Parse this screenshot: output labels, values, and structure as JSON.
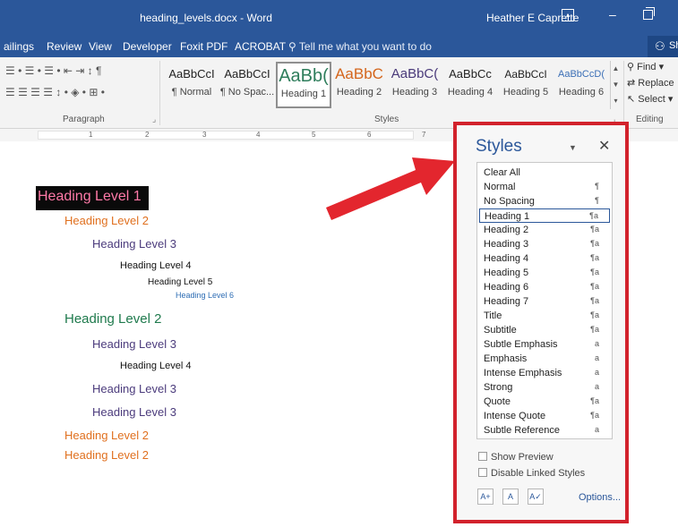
{
  "titlebar": {
    "doc_title": "heading_levels.docx - Word",
    "user": "Heather E Caprette",
    "ribbon_display_icon": "ribbon-display-options-icon",
    "minimize_glyph": "–",
    "restore_icon": "restore-window-icon"
  },
  "tabs": {
    "items": [
      "ailings",
      "Review",
      "View",
      "Developer",
      "Foxit PDF",
      "ACROBAT"
    ],
    "tell_me": "Tell me what you want to do",
    "share": "Sh"
  },
  "ribbon": {
    "paragraph_label": "Paragraph",
    "styles_label": "Styles",
    "editing_label": "Editing",
    "paragraph_row1": "☰ • ☰ • ☰ • ⇤ ⇥  ↕  ¶",
    "paragraph_row2": "☰ ☰ ☰ ☰  ↕ •  ◈ •  ⊞ •",
    "gallery": [
      {
        "sample": "AaBbCcI",
        "name": "¶ Normal",
        "color": "#222222"
      },
      {
        "sample": "AaBbCcI",
        "name": "¶ No Spac...",
        "color": "#222222"
      },
      {
        "sample": "AaBb(",
        "name": "Heading 1",
        "color": "#2e7d5b"
      },
      {
        "sample": "AaBbC",
        "name": "Heading 2",
        "color": "#d4661c"
      },
      {
        "sample": "AaBbC(",
        "name": "Heading 3",
        "color": "#4a3a7a"
      },
      {
        "sample": "AaBbCc",
        "name": "Heading 4",
        "color": "#222222"
      },
      {
        "sample": "AaBbCcI",
        "name": "Heading 5",
        "color": "#222222"
      },
      {
        "sample": "AaBbCcD(",
        "name": "Heading 6",
        "color": "#3b6fb6"
      }
    ],
    "editing": {
      "find": "Find",
      "replace": "Replace",
      "select": "Select"
    }
  },
  "ruler": {
    "numbers": [
      "1",
      "2",
      "3",
      "4",
      "5",
      "6",
      "7"
    ]
  },
  "document": {
    "headings": [
      {
        "text": "Heading Level 1",
        "level": 1
      },
      {
        "text": "Heading Level 2",
        "level": 2
      },
      {
        "text": "Heading Level 3",
        "level": 3
      },
      {
        "text": "Heading Level 4",
        "level": 4
      },
      {
        "text": "Heading Level 5",
        "level": 5
      },
      {
        "text": "Heading Level 6",
        "level": 6
      },
      {
        "text": "Heading Level 2",
        "level": 2
      },
      {
        "text": "Heading Level 3",
        "level": 3
      },
      {
        "text": "Heading Level 4",
        "level": 4
      },
      {
        "text": "Heading Level 3",
        "level": 3
      },
      {
        "text": "Heading Level 3",
        "level": 3
      },
      {
        "text": "Heading Level 2",
        "level": 2
      },
      {
        "text": "Heading Level 2",
        "level": 2
      }
    ],
    "colors": {
      "h1_text": "#ff7aa8",
      "h1_bg": "#0a0a0a",
      "h2_orange": "#e0701f",
      "h2_green": "#1f7a4d",
      "h3": "#4b3b7c",
      "h4": "#111111",
      "h5": "#111111",
      "h6": "#2e6db4"
    }
  },
  "styles_pane": {
    "title": "Styles",
    "close": "✕",
    "dropdown": "▼",
    "items": [
      {
        "name": "Clear All",
        "type": ""
      },
      {
        "name": "Normal",
        "type": "¶"
      },
      {
        "name": "No Spacing",
        "type": "¶"
      },
      {
        "name": "Heading 1",
        "type": "¶a"
      },
      {
        "name": "Heading 2",
        "type": "¶a"
      },
      {
        "name": "Heading 3",
        "type": "¶a"
      },
      {
        "name": "Heading 4",
        "type": "¶a"
      },
      {
        "name": "Heading 5",
        "type": "¶a"
      },
      {
        "name": "Heading 6",
        "type": "¶a"
      },
      {
        "name": "Heading 7",
        "type": "¶a"
      },
      {
        "name": "Title",
        "type": "¶a"
      },
      {
        "name": "Subtitle",
        "type": "¶a"
      },
      {
        "name": "Subtle Emphasis",
        "type": "a"
      },
      {
        "name": "Emphasis",
        "type": "a"
      },
      {
        "name": "Intense Emphasis",
        "type": "a"
      },
      {
        "name": "Strong",
        "type": "a"
      },
      {
        "name": "Quote",
        "type": "¶a"
      },
      {
        "name": "Intense Quote",
        "type": "¶a"
      },
      {
        "name": "Subtle Reference",
        "type": "a"
      }
    ],
    "selected_item": "Heading 1",
    "show_preview": "Show Preview",
    "disable_linked": "Disable Linked Styles",
    "options": "Options...",
    "buttons": [
      {
        "icon": "new-style-icon",
        "glyph": "A+"
      },
      {
        "icon": "style-inspector-icon",
        "glyph": "A"
      },
      {
        "icon": "manage-styles-icon",
        "glyph": "A✓"
      }
    ],
    "highlight_color": "#d2222c"
  }
}
